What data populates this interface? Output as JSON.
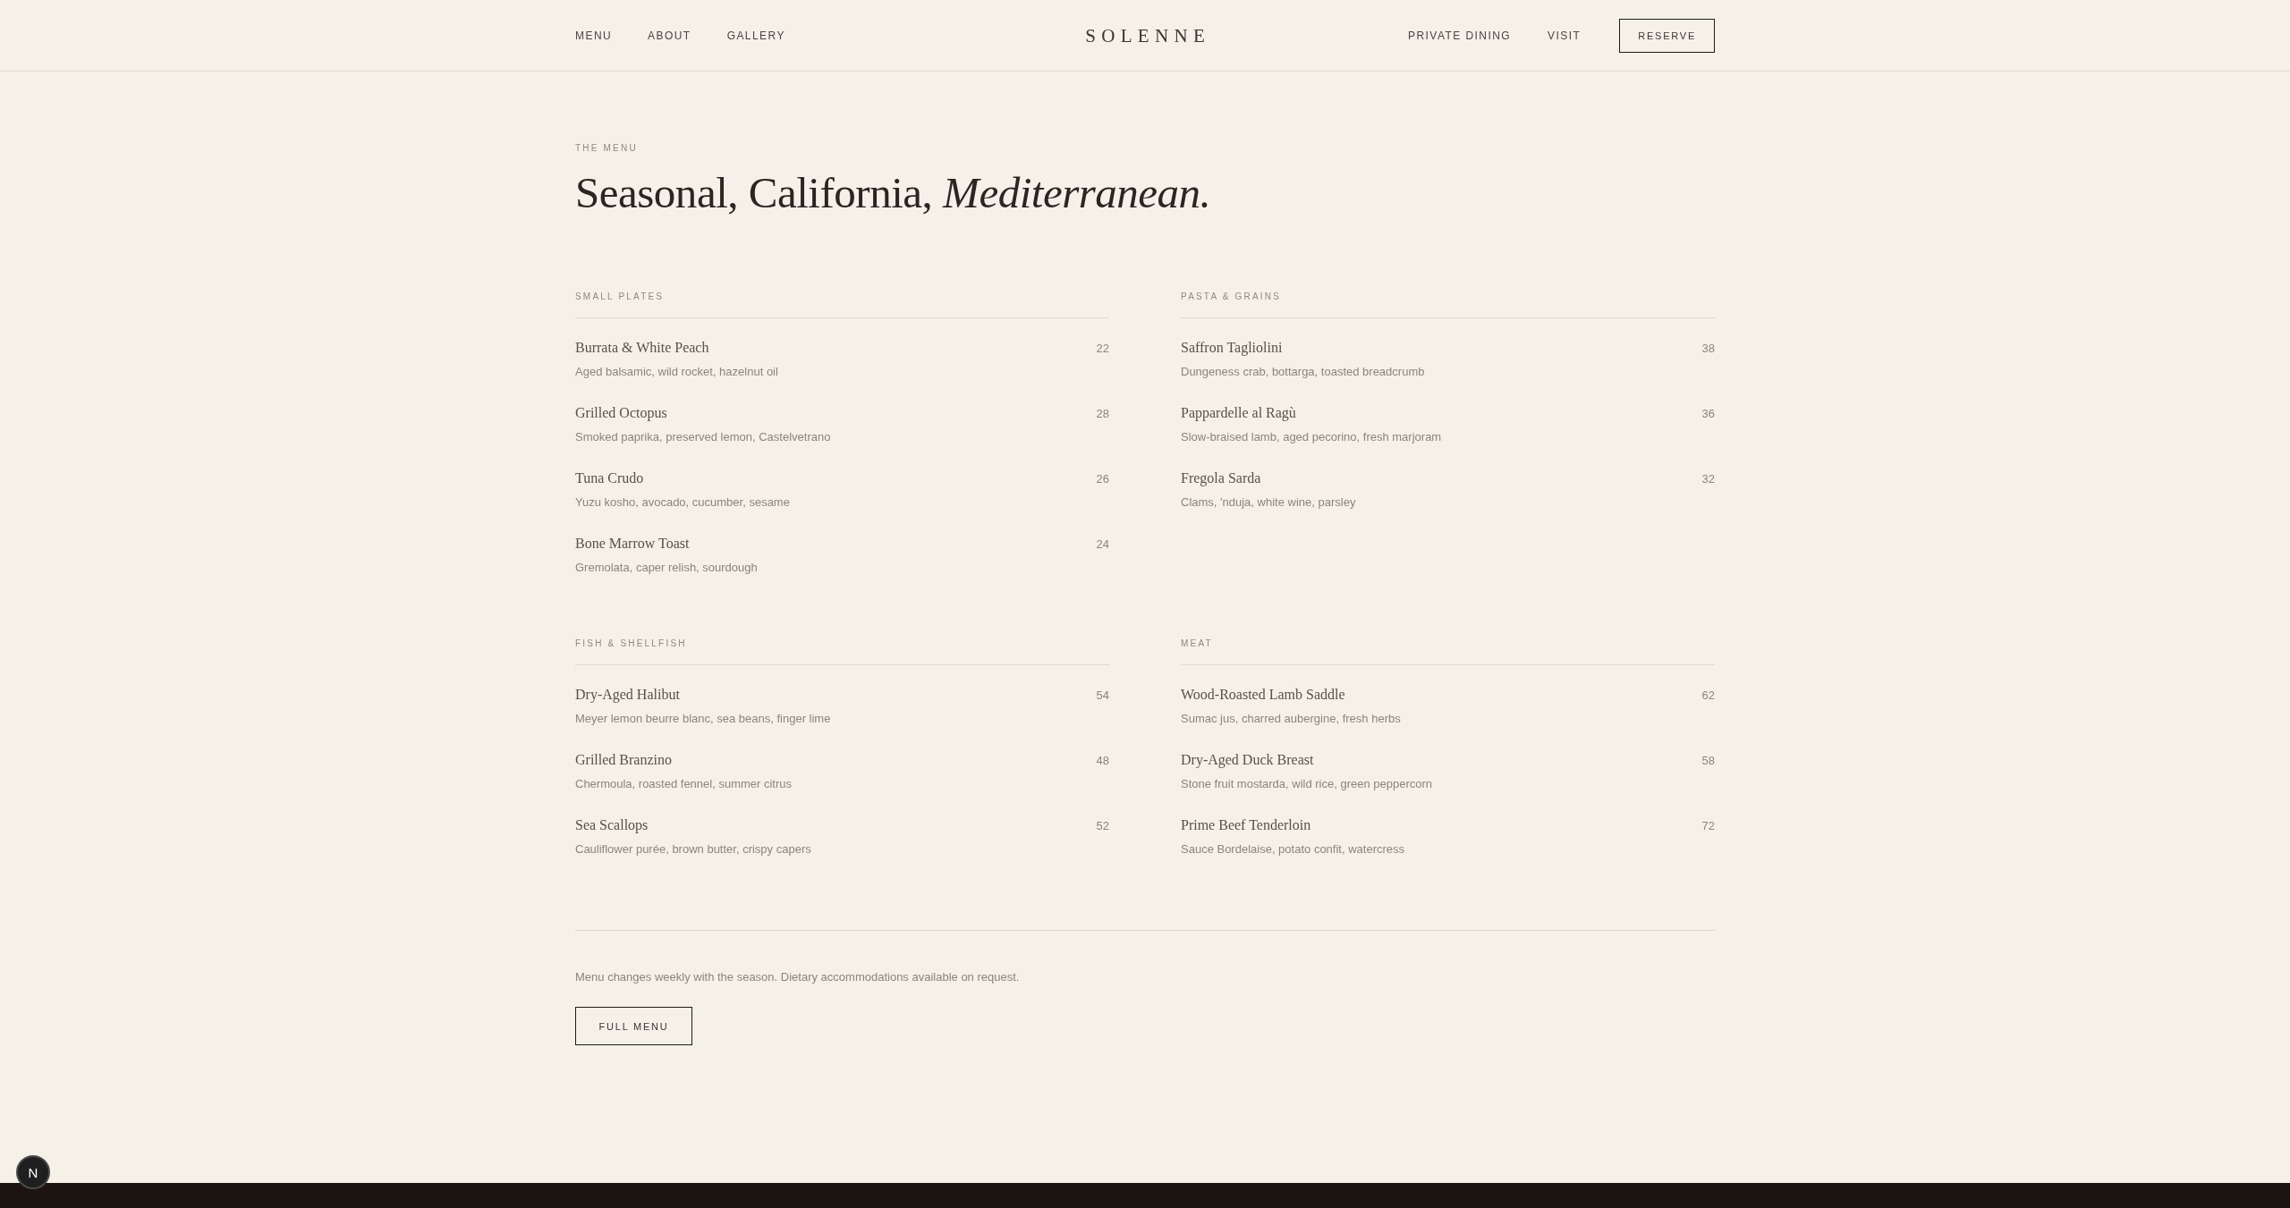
{
  "header": {
    "nav_left": [
      {
        "label": "MENU"
      },
      {
        "label": "ABOUT"
      },
      {
        "label": "GALLERY"
      }
    ],
    "logo": "SOLENNE",
    "nav_right": [
      {
        "label": "PRIVATE DINING"
      },
      {
        "label": "VISIT"
      }
    ],
    "reserve_button": "RESERVE"
  },
  "intro": {
    "eyebrow": "THE MENU",
    "title": "Seasonal, California, *Mediterranean.*"
  },
  "sections": [
    {
      "title": "SMALL PLATES",
      "items": [
        {
          "name": "Burrata & White Peach",
          "description": "Aged balsamic, wild rocket, hazelnut oil",
          "price": "22"
        },
        {
          "name": "Grilled Octopus",
          "description": "Smoked paprika, preserved lemon, Castelvetrano",
          "price": "28"
        },
        {
          "name": "Tuna Crudo",
          "description": "Yuzu kosho, avocado, cucumber, sesame",
          "price": "26"
        },
        {
          "name": "Bone Marrow Toast",
          "description": "Gremolata, caper relish, sourdough",
          "price": "24"
        }
      ]
    },
    {
      "title": "PASTA & GRAINS",
      "items": [
        {
          "name": "Saffron Tagliolini",
          "description": "Dungeness crab, bottarga, toasted breadcrumb",
          "price": "38"
        },
        {
          "name": "Pappardelle al Ragù",
          "description": "Slow-braised lamb, aged pecorino, fresh marjoram",
          "price": "36"
        },
        {
          "name": "Fregola Sarda",
          "description": "Clams, 'nduja, white wine, parsley",
          "price": "32"
        }
      ]
    },
    {
      "title": "FISH & SHELLFISH",
      "items": [
        {
          "name": "Dry-Aged Halibut",
          "description": "Meyer lemon beurre blanc, sea beans, finger lime",
          "price": "54"
        },
        {
          "name": "Grilled Branzino",
          "description": "Chermoula, roasted fennel, summer citrus",
          "price": "48"
        },
        {
          "name": "Sea Scallops",
          "description": "Cauliflower purée, brown butter, crispy capers",
          "price": "52"
        }
      ]
    },
    {
      "title": "MEAT",
      "items": [
        {
          "name": "Wood-Roasted Lamb Saddle",
          "description": "Sumac jus, charred aubergine, fresh herbs",
          "price": "62"
        },
        {
          "name": "Dry-Aged Duck Breast",
          "description": "Stone fruit mostarda, wild rice, green peppercorn",
          "price": "58"
        },
        {
          "name": "Prime Beef Tenderloin",
          "description": "Sauce Bordelaise, potato confit, watercress",
          "price": "72"
        }
      ]
    }
  ],
  "note": "Menu changes weekly with the season. Dietary accommodations available on request.",
  "full_menu_button": "FULL MENU",
  "floating_badge": {
    "label": "N"
  }
}
